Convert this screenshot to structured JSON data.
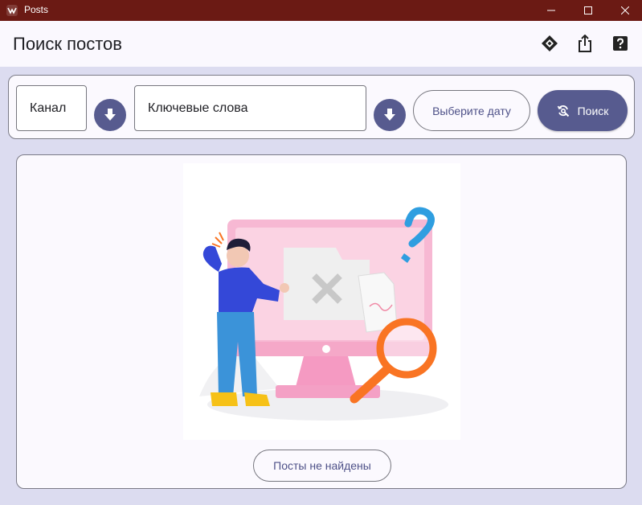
{
  "window": {
    "title": "Posts",
    "icons": {
      "app": "app-logo-icon",
      "minimize": "minimize-icon",
      "maximize": "maximize-icon",
      "close": "close-icon"
    }
  },
  "appbar": {
    "title": "Поиск постов",
    "actions": [
      "diamond-icon",
      "share-icon",
      "help-icon"
    ]
  },
  "search": {
    "channel_label": "Канал",
    "keywords_label": "Ключевые слова",
    "date_button": "Выберите дату",
    "search_button": "Поиск",
    "icons": {
      "download": "arrow-down-icon",
      "search": "refresh-search-icon"
    }
  },
  "results": {
    "empty_label": "Посты не найдены"
  },
  "colors": {
    "titlebar": "#6b1a14",
    "accent": "#575b8f",
    "background": "#dcdcf0",
    "surface": "#fbf9fe"
  }
}
